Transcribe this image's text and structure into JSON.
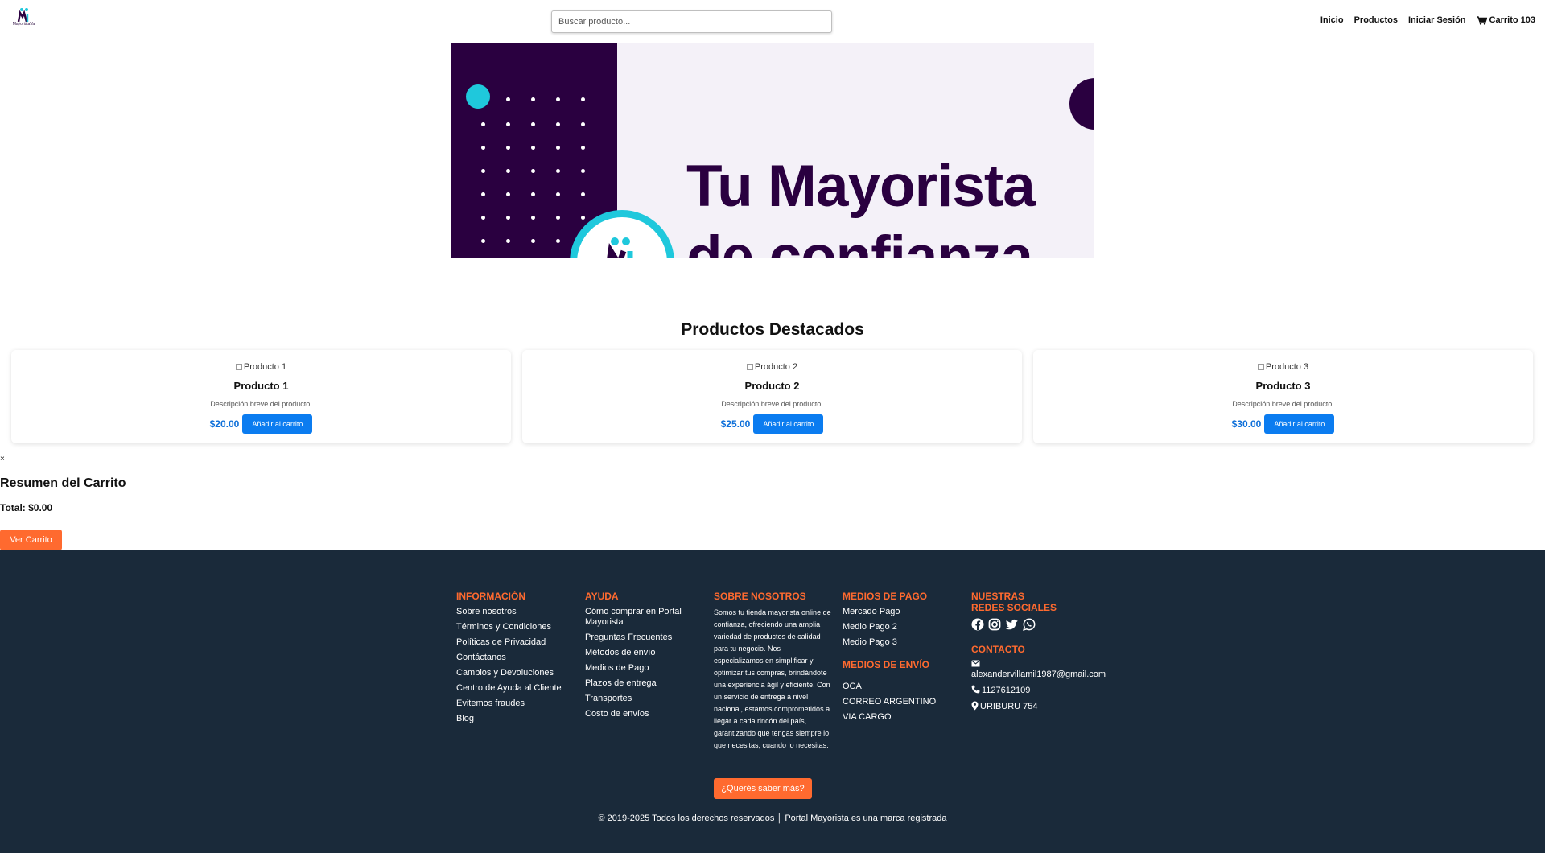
{
  "header": {
    "logo_text": "MayoristaVal",
    "search_placeholder": "Buscar producto...",
    "nav": [
      "Inicio",
      "Productos",
      "Iniciar Sesión"
    ],
    "cart_label": "Carrito 103"
  },
  "banner": {
    "line1": "Tu Mayorista",
    "line2": "de confianza"
  },
  "featured": {
    "title": "Productos Destacados",
    "products": [
      {
        "img_alt": "Producto 1",
        "name": "Producto 1",
        "desc": "Descripción breve del producto.",
        "price": "$20.00",
        "button": "Añadir al carrito"
      },
      {
        "img_alt": "Producto 2",
        "name": "Producto 2",
        "desc": "Descripción breve del producto.",
        "price": "$25.00",
        "button": "Añadir al carrito"
      },
      {
        "img_alt": "Producto 3",
        "name": "Producto 3",
        "desc": "Descripción breve del producto.",
        "price": "$30.00",
        "button": "Añadir al carrito"
      }
    ]
  },
  "cart_summary": {
    "close": "×",
    "title": "Resumen del Carrito",
    "total": "Total: $0.00",
    "button": "Ver Carrito"
  },
  "footer": {
    "info": {
      "title": "INFORMACIÓN",
      "links": [
        "Sobre nosotros",
        "Términos y Condiciones",
        "Políticas de Privacidad",
        "Contáctanos",
        "Cambios y Devoluciones",
        "Centro de Ayuda al Cliente",
        "Evitemos fraudes",
        "Blog"
      ]
    },
    "help": {
      "title": "AYUDA",
      "links": [
        "Cómo comprar en Portal Mayorista",
        "Preguntas Frecuentes",
        "Métodos de envío",
        "Medios de Pago",
        "Plazos de entrega",
        "Transportes",
        "Costo de envíos"
      ]
    },
    "about": {
      "title": "SOBRE NOSOTROS",
      "text": "Somos tu tienda mayorista online de confianza, ofreciendo una amplia variedad de productos de calidad para tu negocio. Nos especializamos en simplificar y optimizar tus compras, brindándote una experiencia ágil y eficiente. Con un servicio de entrega a nivel nacional, estamos comprometidos a llegar a cada rincón del país, garantizando que tengas siempre lo que necesitas, cuando lo necesitas.",
      "button": "¿Querés saber más?"
    },
    "payment": {
      "title": "MEDIOS DE PAGO",
      "links": [
        "Mercado Pago",
        "Medio Pago 2",
        "Medio Pago 3"
      ]
    },
    "shipping": {
      "title": "MEDIOS DE ENVÍO",
      "links": [
        "OCA",
        "CORREO ARGENTINO",
        "VIA CARGO"
      ]
    },
    "social": {
      "title": "NUESTRAS REDES SOCIALES",
      "icons": [
        "facebook-icon",
        "instagram-icon",
        "twitter-icon",
        "whatsapp-icon"
      ]
    },
    "contact": {
      "title": "CONTACTO",
      "email": "alexandervillamil1987@gmail.com",
      "phone": "1127612109",
      "address": "URIBURU 754"
    },
    "copyright": "© 2019-2025 Todos los derechos reservados │ Portal Mayorista es una marca registrada"
  },
  "colors": {
    "accent": "#ff6a2f",
    "button_blue": "#0b7cf0",
    "price_blue": "#0d6fd9",
    "footer_bg": "#1a2a3a",
    "banner_purple": "#2a0040",
    "banner_cyan": "#1fc8dc"
  }
}
